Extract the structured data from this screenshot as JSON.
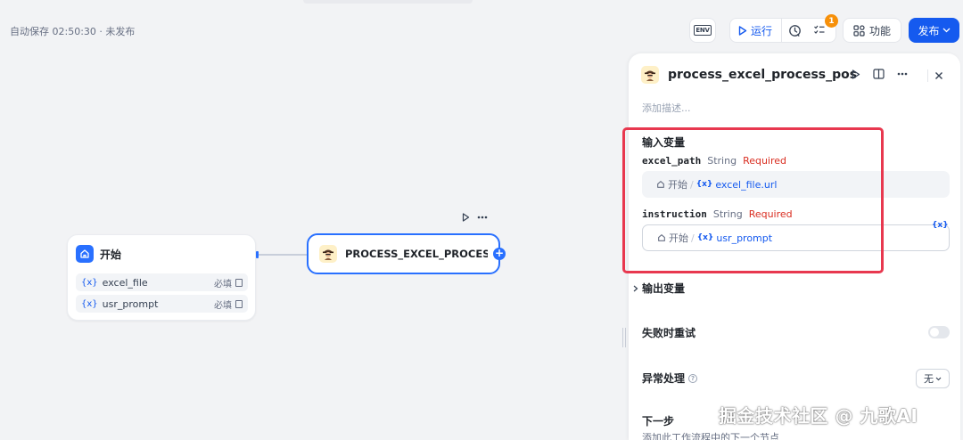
{
  "header": {
    "autosave": "自动保存 02:50:30 · 未发布",
    "env_label": "ENV",
    "run_label": "运行",
    "badge_count": "1",
    "features_label": "功能",
    "publish_label": "发布"
  },
  "canvas": {
    "start_node": {
      "title": "开始",
      "variables": [
        {
          "name": "excel_file",
          "required": "必填"
        },
        {
          "name": "usr_prompt",
          "required": "必填"
        }
      ]
    },
    "process_node": {
      "title": "PROCESS_EXCEL_PROCESS_POST"
    }
  },
  "panel": {
    "title": "process_excel_process_pos",
    "description_placeholder": "添加描述...",
    "input_section": "输入变量",
    "params": [
      {
        "name": "excel_path",
        "type": "String",
        "required": "Required",
        "source_node": "开始",
        "source_var": "excel_file.url"
      },
      {
        "name": "instruction",
        "type": "String",
        "required": "Required",
        "source_node": "开始",
        "source_var": "usr_prompt"
      }
    ],
    "var_symbol": "{x}",
    "output_section": "输出变量",
    "retry_label": "失败时重试",
    "exception_label": "异常处理",
    "exception_value": "无",
    "next_label": "下一步",
    "next_desc": "添加此工作流程中的下一个节点"
  },
  "watermark": "掘金技术社区 @ 九歌AI",
  "colors": {
    "accent": "#155aef",
    "required": "#d92d20",
    "highlight": "#e8384f",
    "badge": "#f79009"
  }
}
